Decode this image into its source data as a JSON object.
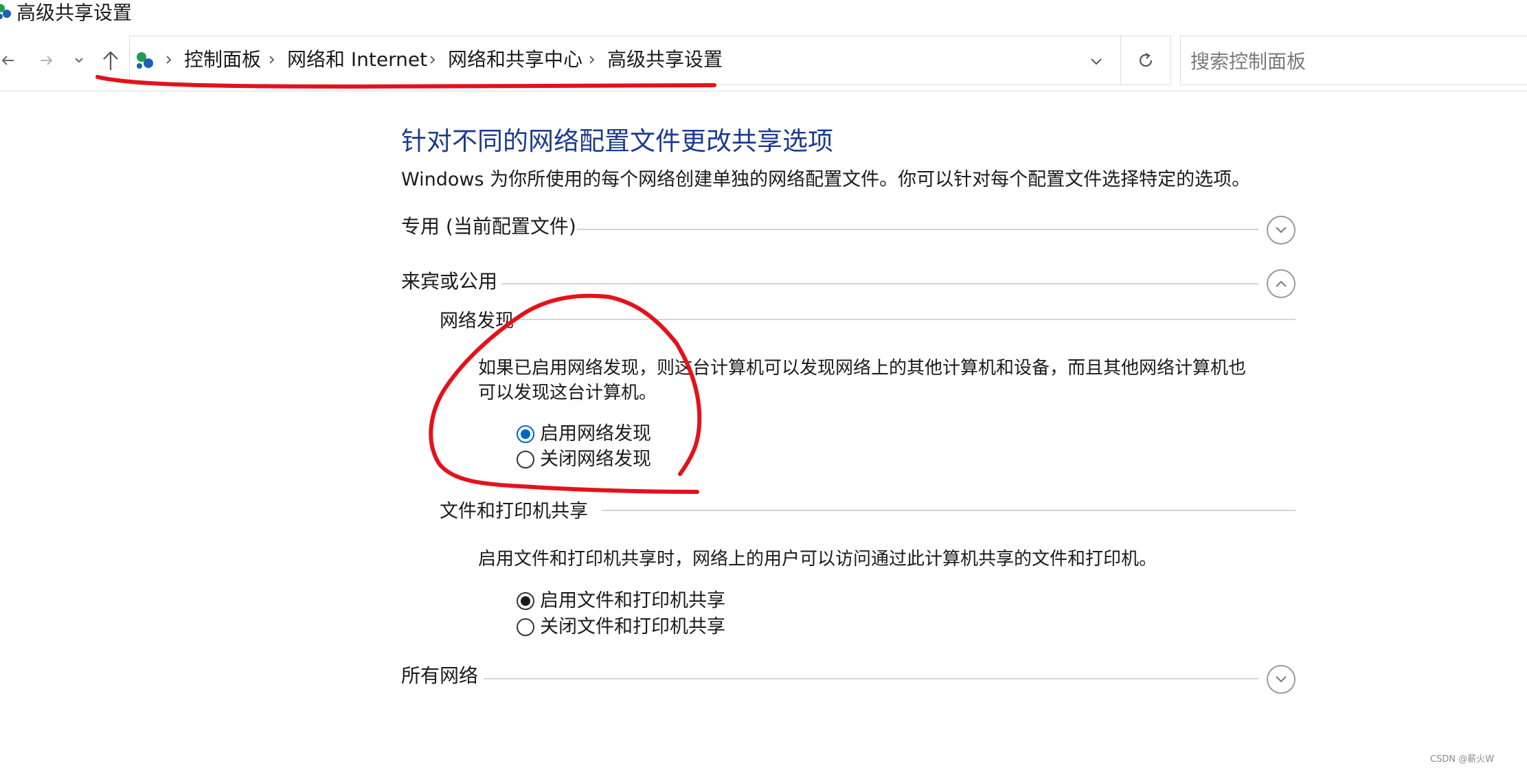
{
  "window": {
    "title": "高级共享设置",
    "icon": "network-icon"
  },
  "nav": {
    "back_icon": "back-arrow-icon",
    "forward_icon": "forward-arrow-icon",
    "recent_icon": "chevron-down-icon",
    "up_icon": "up-arrow-icon",
    "breadcrumb": [
      "控制面板",
      "网络和 Internet",
      "网络和共享中心",
      "高级共享设置"
    ],
    "dropdown_icon": "chevron-down-icon",
    "refresh_icon": "refresh-icon",
    "search_placeholder": "搜索控制面板"
  },
  "content": {
    "heading": "针对不同的网络配置文件更改共享选项",
    "description": "Windows 为你所使用的每个网络创建单独的网络配置文件。你可以针对每个配置文件选择特定的选项。",
    "profiles": [
      {
        "label": "专用 (当前配置文件)",
        "expanded": false
      },
      {
        "label": "来宾或公用",
        "expanded": true
      },
      {
        "label": "所有网络",
        "expanded": false
      }
    ],
    "network_discovery": {
      "label": "网络发现",
      "text_line1": "如果已启用网络发现，则这台计算机可以发现网络上的其他计算机和设备，而且其他网络计算机也",
      "text_line2": "可以发现这台计算机。",
      "options": [
        "启用网络发现",
        "关闭网络发现"
      ],
      "selected": 0
    },
    "file_printer_sharing": {
      "label": "文件和打印机共享",
      "text": "启用文件和打印机共享时，网络上的用户可以访问通过此计算机共享的文件和打印机。",
      "options": [
        "启用文件和打印机共享",
        "关闭文件和打印机共享"
      ],
      "selected": 0
    }
  },
  "watermark": "CSDN @薪火W",
  "colors": {
    "heading": "#1c3b8c",
    "radio_blue": "#0067c0",
    "annotation_red": "#e3121b"
  }
}
